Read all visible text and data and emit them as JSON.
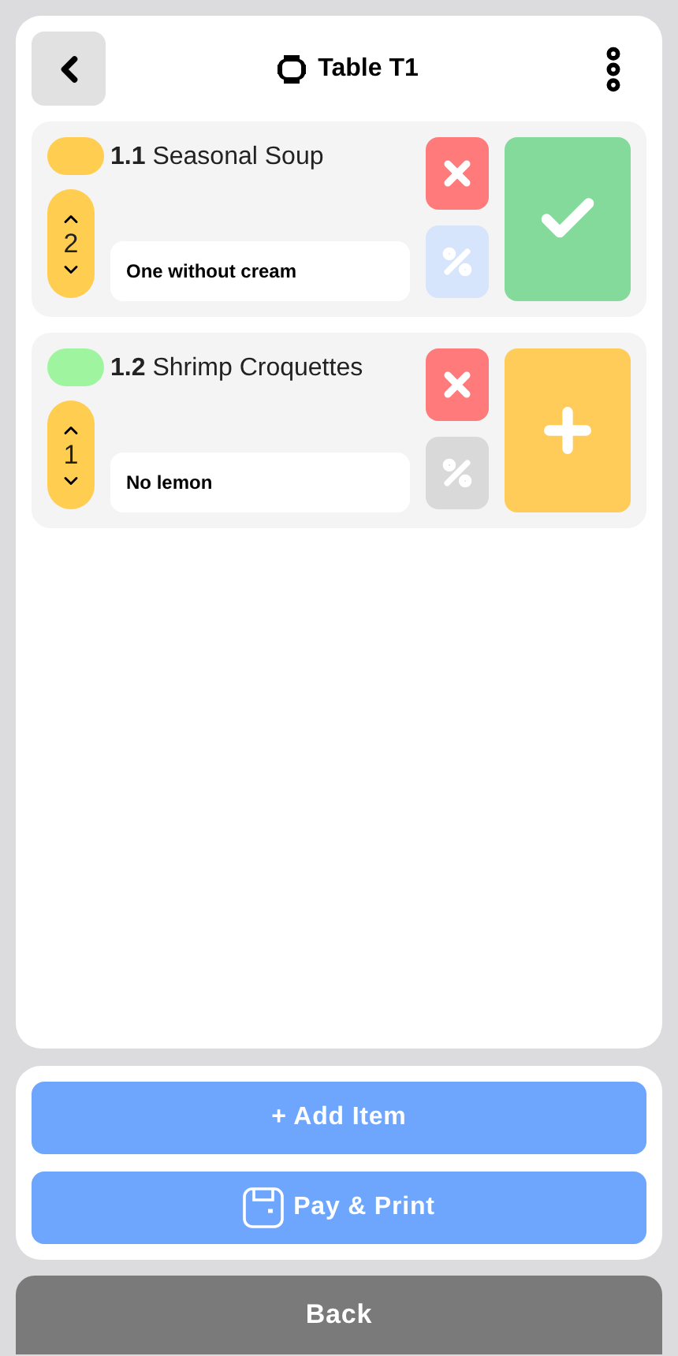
{
  "header": {
    "title": "Table T1"
  },
  "items": [
    {
      "number": "1.1",
      "name": "Seasonal Soup",
      "color": "#ffcd4f",
      "quantity": "2",
      "note": "One without cream",
      "discount": true,
      "kind": "done"
    },
    {
      "number": "1.2",
      "name": "Shrimp Croquettes",
      "color": "#9ff59f",
      "quantity": "1",
      "note": "No lemon",
      "discount": false,
      "kind": "add"
    }
  ],
  "actions": {
    "add": "+ Add Item",
    "pay": "Pay & Print"
  },
  "back_button": "Back"
}
